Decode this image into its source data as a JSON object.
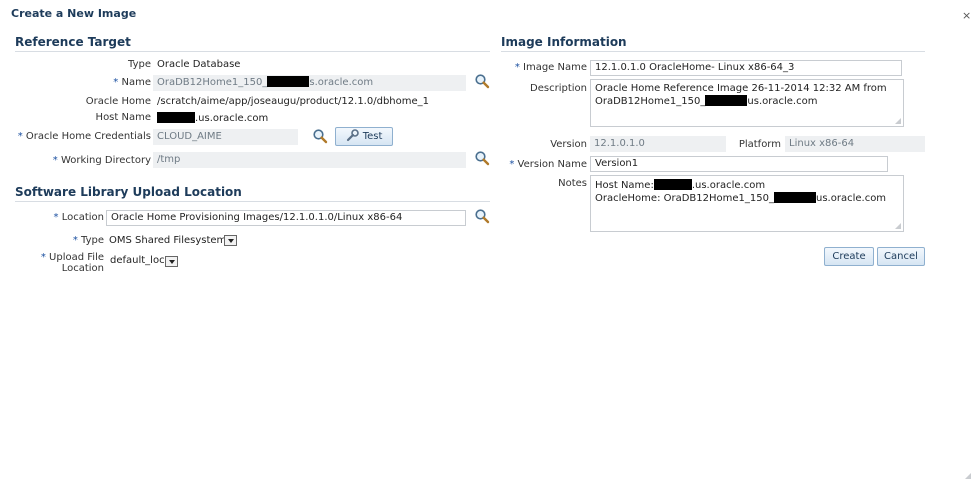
{
  "dialog": {
    "title": "Create a New Image",
    "close": "×"
  },
  "reference_target": {
    "title": "Reference Target",
    "type_label": "Type",
    "type_value": "Oracle Database",
    "name_label": "Name",
    "name_prefix": "OraDB12Home1_150_",
    "name_suffix": "s.oracle.com",
    "oracle_home_label": "Oracle Home",
    "oracle_home_value": "/scratch/aime/app/joseaugu/product/12.1.0/dbhome_1",
    "host_name_label": "Host Name",
    "host_name_suffix": ".us.oracle.com",
    "credentials_label": "Oracle Home Credentials",
    "credentials_value": "CLOUD_AIME",
    "test_button": "Test",
    "working_dir_label": "Working Directory",
    "working_dir_value": "/tmp"
  },
  "software_library": {
    "title": "Software Library Upload Location",
    "location_label": "Location",
    "location_value": "Oracle Home Provisioning Images/12.1.0.1.0/Linux x86-64",
    "type_label": "Type",
    "type_value": "OMS Shared Filesystem",
    "upload_label_1": "Upload File",
    "upload_label_2": "Location",
    "upload_value": "default_loc"
  },
  "image_information": {
    "title": "Image Information",
    "image_name_label": "Image Name",
    "image_name_value": "12.1.0.1.0 OracleHome- Linux x86-64_3",
    "description_label": "Description",
    "description_line1": "Oracle Home Reference Image 26-11-2014 12:32 AM from",
    "description_line2_prefix": "OraDB12Home1_150_",
    "description_line2_suffix": "us.oracle.com",
    "version_label": "Version",
    "version_value": "12.1.0.1.0",
    "platform_label": "Platform",
    "platform_value": "Linux x86-64",
    "version_name_label": "Version Name",
    "version_name_value": "Version1",
    "notes_label": "Notes",
    "notes_line1_prefix": "Host Name:",
    "notes_line1_suffix": ".us.oracle.com",
    "notes_line2_prefix": "OracleHome: OraDB12Home1_150_",
    "notes_line2_suffix": "us.oracle.com"
  },
  "actions": {
    "create": "Create",
    "cancel": "Cancel"
  },
  "required_marker": "*",
  "icons": {
    "search": "magnifier-icon",
    "test": "wrench-icon",
    "dropdown": "chevron-down-icon",
    "resize": "resize-grip-icon"
  },
  "colors": {
    "section_title": "#1d3b5a",
    "required": "#1a4fa0",
    "button_border": "#8fb0cf"
  }
}
